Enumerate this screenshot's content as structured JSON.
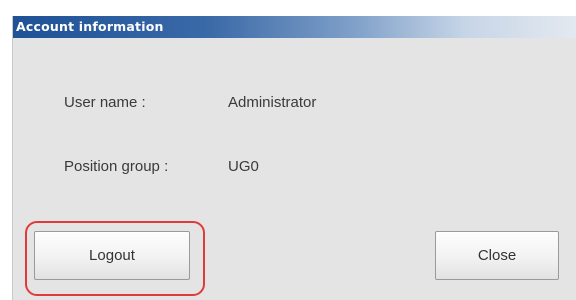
{
  "dialog": {
    "title": "Account information",
    "user_name_label": "User name :",
    "user_name_value": "Administrator",
    "position_group_label": "Position group :",
    "position_group_value": "UG0",
    "logout_label": "Logout",
    "close_label": "Close"
  },
  "colors": {
    "title_bar_start": "#1e5196",
    "dialog_background": "#e4e4e4",
    "highlight": "#e03a3a"
  }
}
